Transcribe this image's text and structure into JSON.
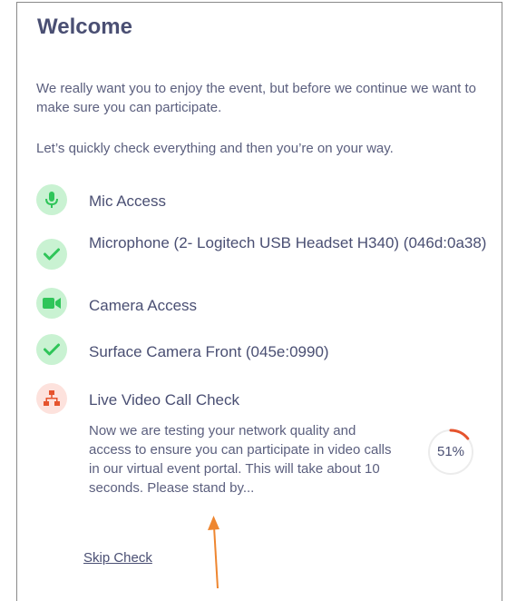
{
  "welcome": {
    "title": "Welcome",
    "intro": "We really want you to enjoy the event, but before we continue we want to make sure you can participate.",
    "instruction": "Let’s quickly check everything and then you’re on your way."
  },
  "checks": [
    {
      "label": "Mic Access",
      "icon": "microphone-icon",
      "status": "ok"
    },
    {
      "label": "Microphone (2- Logitech USB Headset H340) (046d:0a38)",
      "icon": "checkmark-icon",
      "status": "ok"
    },
    {
      "label": "Camera Access",
      "icon": "video-camera-icon",
      "status": "ok"
    },
    {
      "label": "Surface Camera Front (045e:0990)",
      "icon": "checkmark-icon",
      "status": "ok"
    },
    {
      "label": "Live Video Call Check",
      "icon": "network-icon",
      "status": "in-progress"
    }
  ],
  "live_check": {
    "description": "Now we are testing your network quality and access to ensure you can participate in video calls in our virtual event portal. This will take about 10 seconds. Please stand by...",
    "progress_label": "51%",
    "progress_fraction": 0.51,
    "skip_label": "Skip Check"
  },
  "colors": {
    "title": "#4a4f73",
    "body_text": "#5b5f7e",
    "success_bg": "#c9f2d2",
    "success_fg": "#2fc559",
    "warning_bg": "#fde2dd",
    "warning_fg": "#e5532d",
    "progress_track": "#ececec",
    "annotation_arrow": "#ee8630"
  }
}
